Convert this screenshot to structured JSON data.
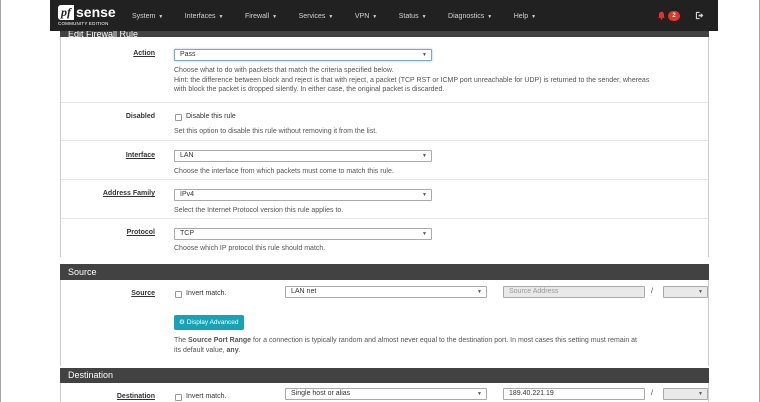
{
  "nav": {
    "logo_prefix": "pf",
    "logo_main": "sense",
    "logo_sub": "COMMUNITY EDITION",
    "items": [
      {
        "label": "System"
      },
      {
        "label": "Interfaces"
      },
      {
        "label": "Firewall"
      },
      {
        "label": "Services"
      },
      {
        "label": "VPN"
      },
      {
        "label": "Status"
      },
      {
        "label": "Diagnostics"
      },
      {
        "label": "Help"
      }
    ],
    "notification_count": "2",
    "colors": {
      "bar": "#212121",
      "badge": "#e6332a",
      "bell": "#e6332a"
    }
  },
  "edit_panel": {
    "title": "Edit Firewall Rule",
    "action": {
      "label": "Action",
      "value": "Pass",
      "help1": "Choose what to do with packets that match the criteria specified below.",
      "help2": "Hint: the difference between block and reject is that with reject, a packet (TCP RST or ICMP port unreachable for UDP) is returned to the sender, whereas",
      "help3": "with block the packet is dropped silently. In either case, the original packet is discarded."
    },
    "disabled": {
      "label": "Disabled",
      "checkbox_label": "Disable this rule",
      "help": "Set this option to disable this rule without removing it from the list."
    },
    "interface": {
      "label": "Interface",
      "value": "LAN",
      "help": "Choose the interface from which packets must come to match this rule."
    },
    "address_family": {
      "label": "Address Family",
      "value": "IPv4",
      "help": "Select the Internet Protocol version this rule applies to."
    },
    "protocol": {
      "label": "Protocol",
      "value": "TCP",
      "help": "Choose which IP protocol this rule should match."
    }
  },
  "source_panel": {
    "title": "Source",
    "label": "Source",
    "invert_label": "Invert match.",
    "type_value": "LAN net",
    "address_placeholder": "Source Address",
    "slash": "/",
    "advanced_button": "Display Advanced",
    "help_pre": "The ",
    "help_bold": "Source Port Range",
    "help_post": " for a connection is typically random and almost never equal to the destination port. In most cases this setting must remain at",
    "help_line2_pre": "its default value, ",
    "help_line2_bold": "any",
    "help_line2_post": ".",
    "button_color": "#17a2b8"
  },
  "destination_panel": {
    "title": "Destination",
    "label": "Destination",
    "invert_label": "Invert match.",
    "type_value": "Single host or alias",
    "address_value": "189.40.221.19",
    "slash": "/"
  }
}
